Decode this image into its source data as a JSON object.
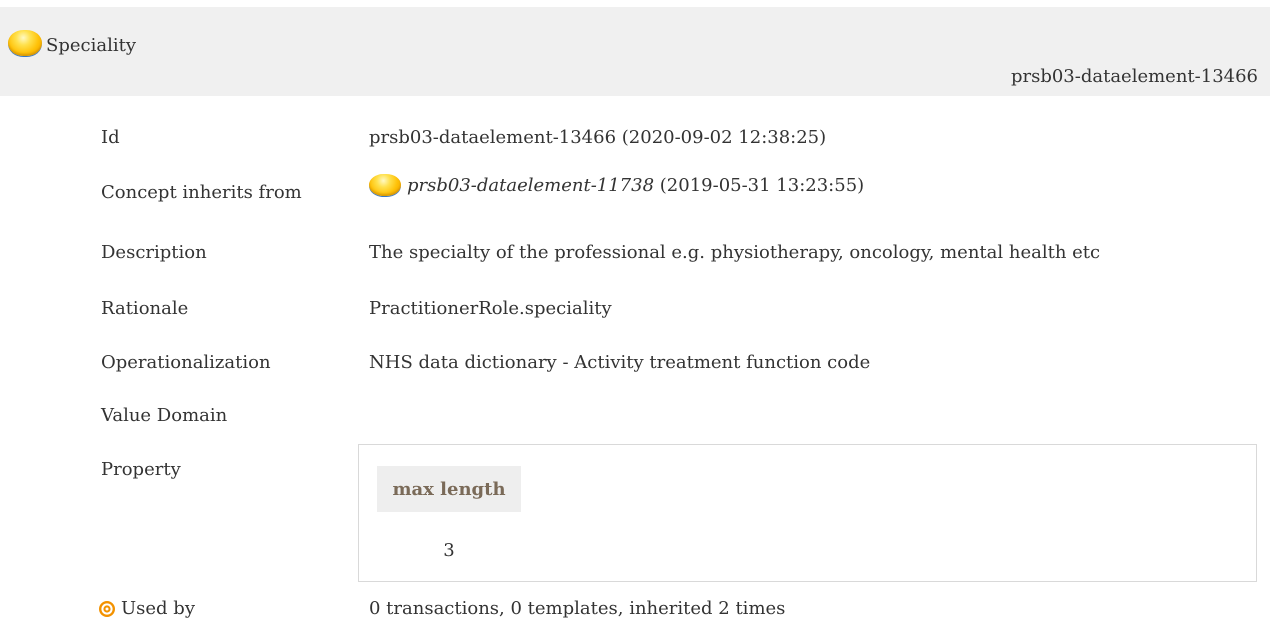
{
  "header": {
    "title": "Speciality",
    "id": "prsb03-dataelement-13466",
    "status_icon": "status-orb-icon"
  },
  "rows": {
    "id": {
      "label": "Id",
      "value": "prsb03-dataelement-13466 (2020-09-02 12:38:25)"
    },
    "inherits": {
      "label": "Concept inherits from",
      "ref_id": "prsb03-dataelement-11738",
      "ref_date": "(2019-05-31 13:23:55)"
    },
    "description": {
      "label": "Description",
      "value": "The specialty of the professional e.g. physiotherapy, oncology, mental health etc"
    },
    "rationale": {
      "label": "Rationale",
      "value": "PractitionerRole.speciality"
    },
    "operationalization": {
      "label": "Operationalization",
      "value": "NHS data dictionary - Activity treatment function code"
    },
    "value_domain": {
      "label": "Value Domain"
    },
    "property": {
      "label": "Property",
      "column_header": "max length",
      "column_value": "3"
    },
    "used_by": {
      "label": "Used by",
      "value": "0 transactions, 0 templates, inherited 2 times"
    }
  },
  "colors": {
    "header_bg": "#f0f0f0",
    "property_header_text": "#7a6a58",
    "target_icon": "#f39200"
  }
}
